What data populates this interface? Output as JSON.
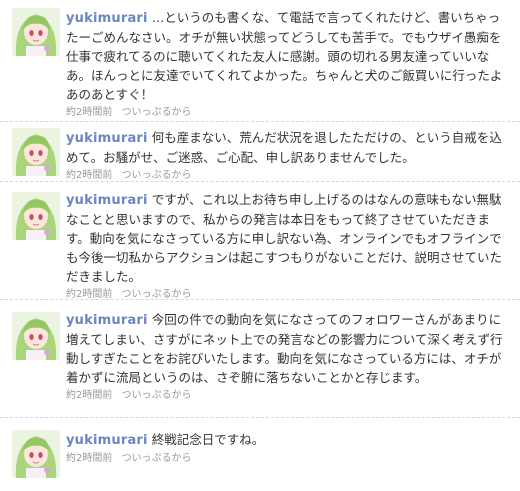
{
  "tweets": [
    {
      "user": "yukimurari",
      "text": "…というのも書くな、て電話で言ってくれたけど、書いちゃったーごめんなさい。オチが無い状態ってどうしても苦手で。でもウザイ愚痴を仕事で疲れてるのに聴いてくれた友人に感謝。頭の切れる男友達っていいなあ。ほんっとに友達でいてくれてよかった。ちゃんと犬のご飯買いに行ったよあのあとすぐ！",
      "time": "約2時間前",
      "via_prefix": "",
      "via": "ついっぷるから"
    },
    {
      "user": "yukimurari",
      "text": "何も産まない、荒んだ状況を退したただけの、という自戒を込めて。お騒がせ、ご迷惑、ご心配、申し訳ありませんでした。",
      "time": "約2時間前",
      "via_prefix": "",
      "via": "ついっぷるから"
    },
    {
      "user": "yukimurari",
      "text": "ですが、これ以上お待ち申し上げるのはなんの意味もない無駄なことと思いますので、私からの発言は本日をもって終了させていただきます。動向を気になさっている方に申し訳ない為、オンラインでもオフラインでも今後一切私からアクションは起こすつもりがないことだけ、説明させていただきました。",
      "time": "約2時間前",
      "via_prefix": "",
      "via": "ついっぷるから"
    },
    {
      "user": "yukimurari",
      "text": "今回の件での動向を気になさってのフォロワーさんがあまりに増えてしまい、さすがにネット上での発言などの影響力について深く考えず行動しすぎたことをお詫びいたします。動向を気になさっている方には、オチが着かずに流局というのは、さぞ腑に落ちないことかと存じます。",
      "time": "約2時間前",
      "via_prefix": "",
      "via": "ついっぷるから"
    },
    {
      "user": "yukimurari",
      "text": "終戦記念日ですね。",
      "time": "約2時間前",
      "via_prefix": "",
      "via": "ついっぷるから"
    }
  ],
  "colors": {
    "username": "#6b86c4",
    "text": "#333333",
    "meta": "#999999",
    "divider": "#d6d6d6"
  },
  "avatar_icon": "anime-girl-green-hair-avatar"
}
